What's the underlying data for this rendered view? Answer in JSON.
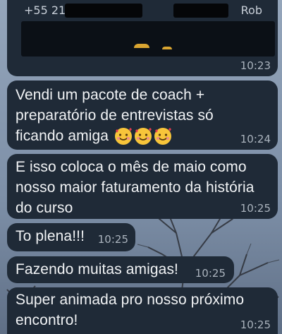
{
  "header": {
    "phone": "+55 21",
    "name": "Rob",
    "time": "10:23"
  },
  "messages": [
    {
      "text": "Vendi um pacote de coach + preparatório de entrevistas só ficando amiga",
      "emoji": "smiling-face-with-hearts-icon",
      "time": "10:24"
    },
    {
      "text": "E isso coloca o mês de maio como nosso maior faturamento da história do curso",
      "time": "10:25"
    },
    {
      "text": "To plena!!!",
      "time": "10:25"
    },
    {
      "text": "Fazendo muitas amigas!",
      "time": "10:25"
    },
    {
      "text": "Super animada pro nosso próximo encontro!",
      "time": "10:25"
    }
  ],
  "colors": {
    "bubble": "#1f2a37",
    "text": "#f1f3f5",
    "timestamp": "#aab3bd"
  }
}
